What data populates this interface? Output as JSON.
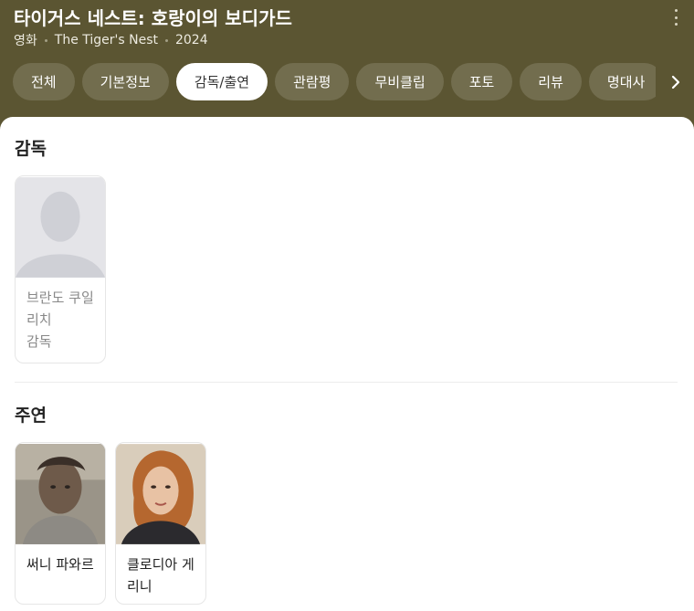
{
  "header": {
    "title": "타이거스 네스트: 호랑이의 보디가드",
    "category": "영화",
    "original_title": "The Tiger's Nest",
    "year": "2024"
  },
  "tabs": [
    {
      "label": "전체"
    },
    {
      "label": "기본정보"
    },
    {
      "label": "감독/출연",
      "active": true
    },
    {
      "label": "관람평"
    },
    {
      "label": "무비클립"
    },
    {
      "label": "포토"
    },
    {
      "label": "리뷰"
    },
    {
      "label": "명대사"
    }
  ],
  "sections": {
    "director": {
      "title": "감독",
      "people": [
        {
          "name": "브란도 쿠일리치",
          "role": "감독"
        }
      ]
    },
    "cast": {
      "title": "주연",
      "people": [
        {
          "name": "써니 파와르"
        },
        {
          "name": "클로디아 게리니"
        }
      ]
    }
  },
  "icons": {
    "more": "more-vertical-icon",
    "next": "chevron-right-icon",
    "placeholder": "person-silhouette-icon"
  },
  "colors": {
    "header_bg": "#5b5532",
    "active_tab_bg": "#ffffff"
  }
}
